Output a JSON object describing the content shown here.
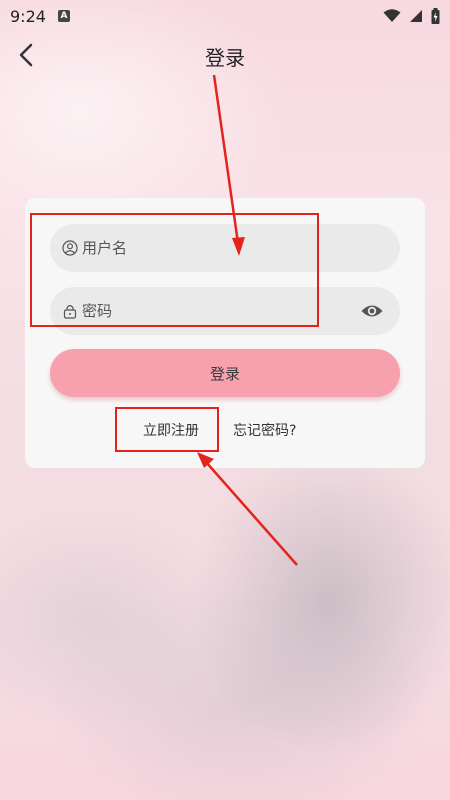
{
  "status_bar": {
    "time": "9:24",
    "notification_icon": "a-icon",
    "icons": [
      "wifi-icon",
      "signal-icon",
      "battery-icon"
    ]
  },
  "header": {
    "title": "登录",
    "back_icon": "chevron-left-icon"
  },
  "form": {
    "username": {
      "placeholder": "用户名",
      "value": "",
      "icon": "user-circle-icon"
    },
    "password": {
      "placeholder": "密码",
      "value": "",
      "icon": "lock-icon",
      "toggle_icon": "eye-icon"
    },
    "submit_label": "登录",
    "register_label": "立即注册",
    "forgot_label": "忘记密码?"
  },
  "colors": {
    "button": "#f6a1ad",
    "annotation": "#e4231c",
    "field": "#eaeaea"
  }
}
